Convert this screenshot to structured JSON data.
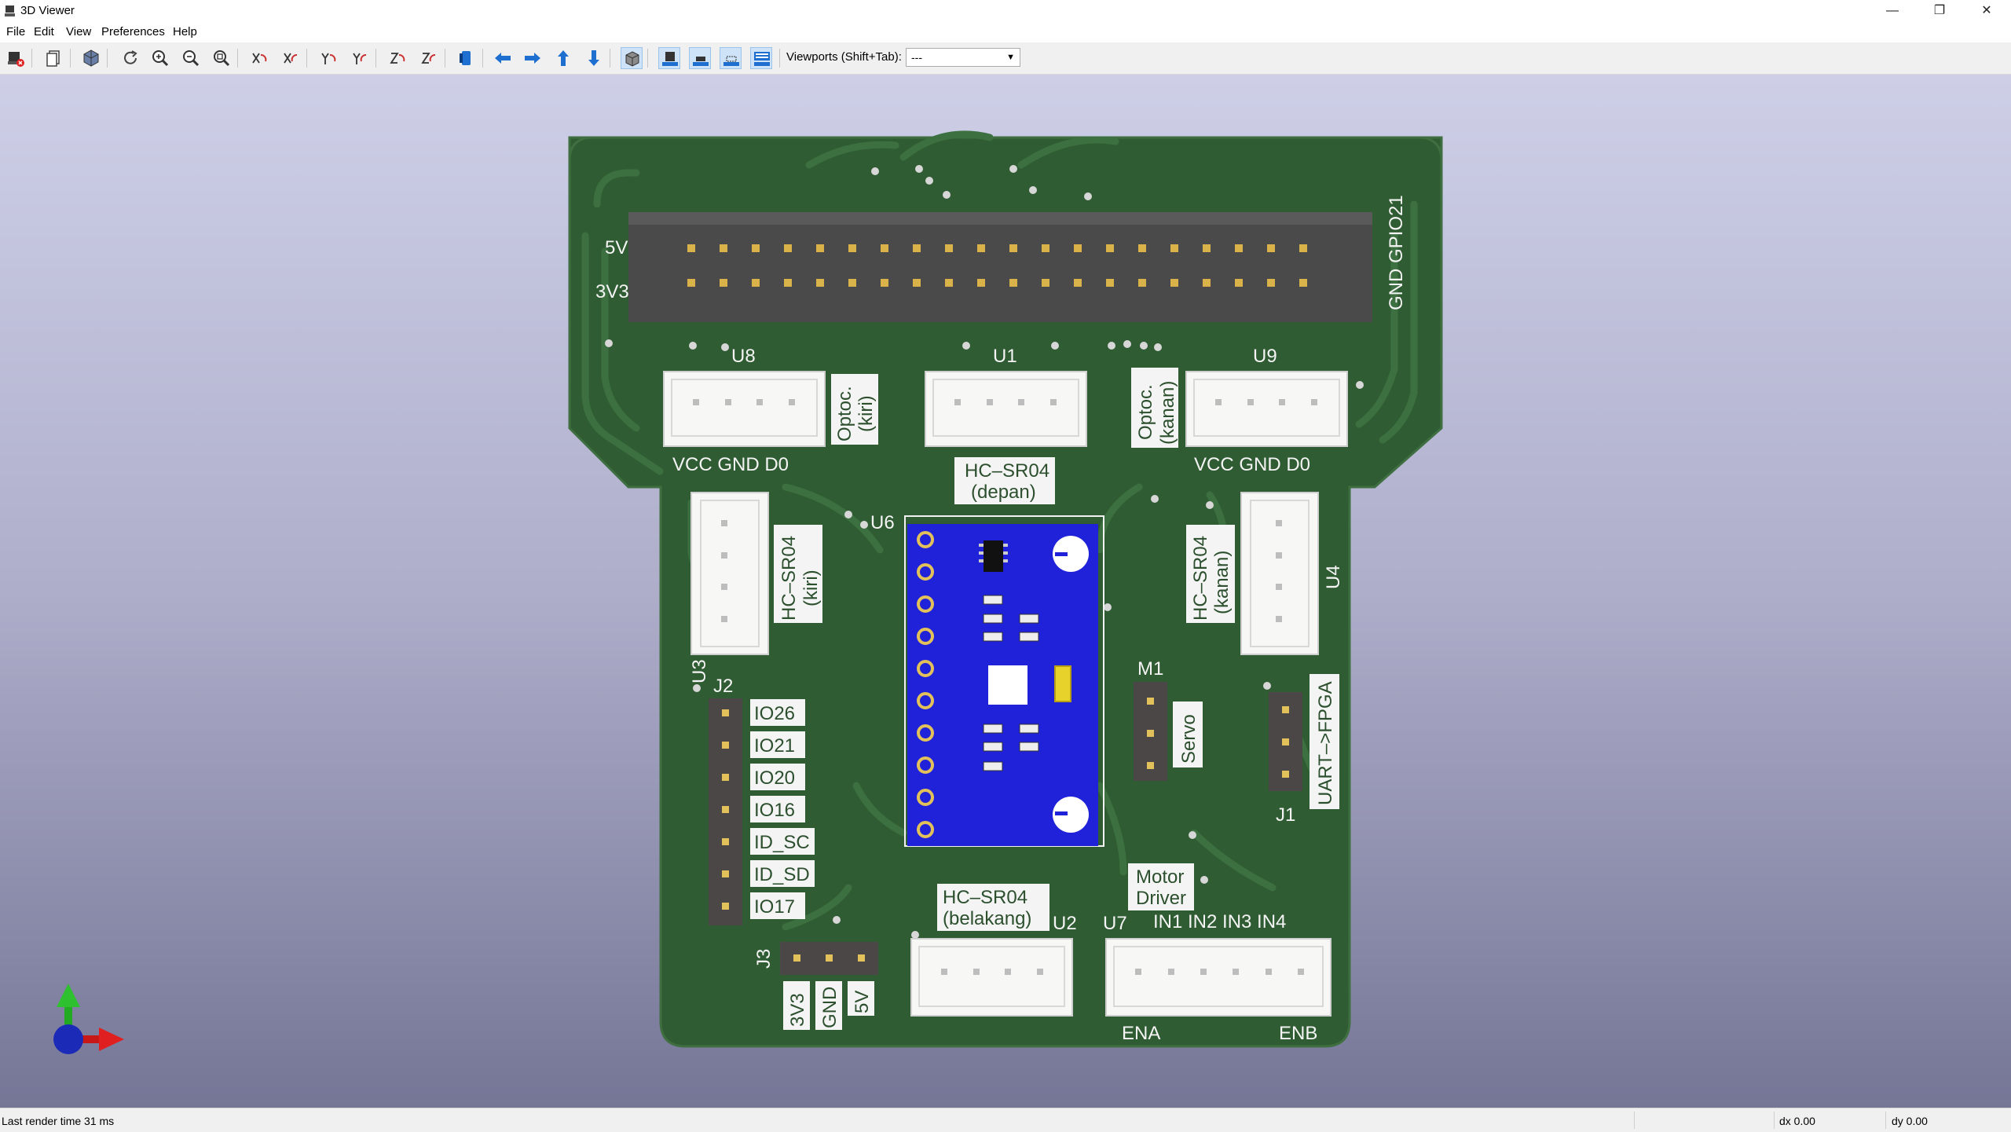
{
  "window": {
    "title": "3D Viewer",
    "minimize": "—",
    "maximize": "❐",
    "close": "✕"
  },
  "menu": [
    "File",
    "Edit",
    "View",
    "Preferences",
    "Help"
  ],
  "toolbar": {
    "viewports_label": "Viewports (Shift+Tab):",
    "viewports_value": "---",
    "buttons": [
      "exit-icon",
      "copy-image-icon",
      "raytrace-icon",
      "refresh-icon",
      "zoom-in-icon",
      "zoom-out-icon",
      "zoom-fit-icon",
      "rotate-x-cw-icon",
      "rotate-x-ccw-icon",
      "rotate-y-cw-icon",
      "rotate-y-ccw-icon",
      "rotate-z-cw-icon",
      "rotate-z-ccw-icon",
      "flip-board-icon",
      "pan-left-icon",
      "pan-right-icon",
      "pan-up-icon",
      "pan-down-icon",
      "ortho-icon",
      "show-tht-icon",
      "show-smd-icon",
      "show-virtual-icon",
      "show-not-in-posfile-icon"
    ]
  },
  "board": {
    "header_labels": {
      "five_v": "5V",
      "three_v3": "3V3",
      "gnd": "GND",
      "gpio21": "GPIO21"
    },
    "refs": {
      "u8": "U8",
      "u1": "U1",
      "u9": "U9",
      "u6": "U6",
      "u4": "U4",
      "u3": "U3",
      "j2": "J2",
      "m1": "M1",
      "j1": "J1",
      "j3": "J3",
      "u2": "U2",
      "u7": "U7"
    },
    "silk": {
      "optoc_kiri": [
        "Optoc.",
        "(kiri)"
      ],
      "optoc_kanan": [
        "Optoc.",
        "(kanan)"
      ],
      "vcc_gnd_d0": "VCC GND D0",
      "hcsr_depan": [
        "HC–SR04",
        "(depan)"
      ],
      "hcsr_kiri": [
        "HC–SR04",
        "(kiri)"
      ],
      "hcsr_kanan": [
        "HC–SR04",
        "(kanan)"
      ],
      "hcsr_belakang": [
        "HC–SR04",
        "(belakang)"
      ],
      "servo": "Servo",
      "uart": "UART–>FPGA",
      "motor_driver": [
        "Motor",
        "Driver"
      ],
      "in_labels": "IN1 IN2 IN3 IN4",
      "ena": "ENA",
      "enb": "ENB",
      "j2_pins": [
        "IO26",
        "IO21",
        "IO20",
        "IO16",
        "ID_SC",
        "ID_SD",
        "IO17"
      ],
      "j3_pins": [
        "3V3",
        "GND",
        "5V"
      ]
    }
  },
  "status": {
    "render_time": "Last render time 31 ms",
    "dx": "dx 0.00",
    "dy": "dy 0.00"
  }
}
